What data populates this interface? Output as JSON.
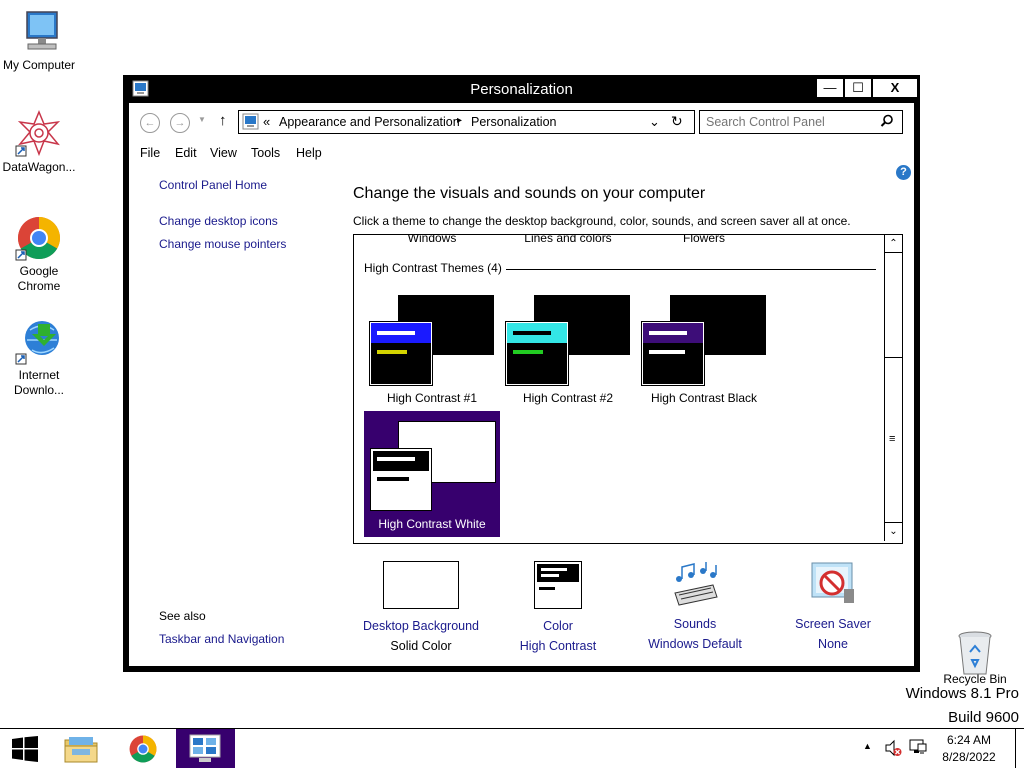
{
  "desktop": {
    "icons": [
      {
        "label": "My Computer"
      },
      {
        "label": "DataWagon..."
      },
      {
        "label": "Google Chrome"
      },
      {
        "label": "Internet Downlo..."
      },
      {
        "label": "Recycle Bin"
      }
    ],
    "watermark_line1": "Windows 8.1 Pro",
    "watermark_line2": "Build 9600"
  },
  "window": {
    "title": "Personalization",
    "controls": {
      "minimize": "—",
      "maximize": "☐",
      "close": "X"
    },
    "address": {
      "prefix": "«",
      "crumbs": [
        "Appearance and Personalization",
        "Personalization"
      ],
      "separator": "▸"
    },
    "search": {
      "placeholder": "Search Control Panel"
    },
    "menu": [
      "File",
      "Edit",
      "View",
      "Tools",
      "Help"
    ],
    "help_icon": "?",
    "sidebar": {
      "home": "Control Panel Home",
      "links": [
        "Change desktop icons",
        "Change mouse pointers"
      ],
      "see_also_heading": "See also",
      "see_also_links": [
        "Taskbar and Navigation"
      ]
    },
    "main": {
      "heading": "Change the visuals and sounds on your computer",
      "subheading": "Click a theme to change the desktop background, color, sounds, and screen saver all at once.",
      "partial_row": [
        "Windows",
        "Lines and colors",
        "Flowers"
      ],
      "group_header": "High Contrast Themes (4)",
      "themes": [
        {
          "name": "High Contrast #1",
          "bar_color": "#1a1aff",
          "line1": "#ffffff",
          "line2": "#d4d400",
          "selected": false
        },
        {
          "name": "High Contrast #2",
          "bar_color": "#33e6e6",
          "line1": "#000000",
          "line2": "#22cc22",
          "selected": false
        },
        {
          "name": "High Contrast Black",
          "bar_color": "#3d0d78",
          "line1": "#ffffff",
          "line2": "#ffffff",
          "selected": false
        },
        {
          "name": "High Contrast White",
          "bar_color": "#ffffff",
          "line1": "#000000",
          "line2": "#000000",
          "selected": true
        }
      ],
      "selection_color": "#37006e"
    },
    "bottom": [
      {
        "label": "Desktop Background",
        "value": "Solid Color",
        "icon": "desktop-background-icon"
      },
      {
        "label": "Color",
        "value": "High Contrast",
        "icon": "color-icon"
      },
      {
        "label": "Sounds",
        "value": "Windows Default",
        "icon": "sounds-icon"
      },
      {
        "label": "Screen Saver",
        "value": "None",
        "icon": "screen-saver-icon"
      }
    ]
  },
  "taskbar": {
    "apps": [
      "start-icon",
      "file-explorer-icon",
      "chrome-icon",
      "control-panel-icon"
    ],
    "tray_arrow": "▲",
    "time": "6:24 AM",
    "date": "8/28/2022"
  }
}
